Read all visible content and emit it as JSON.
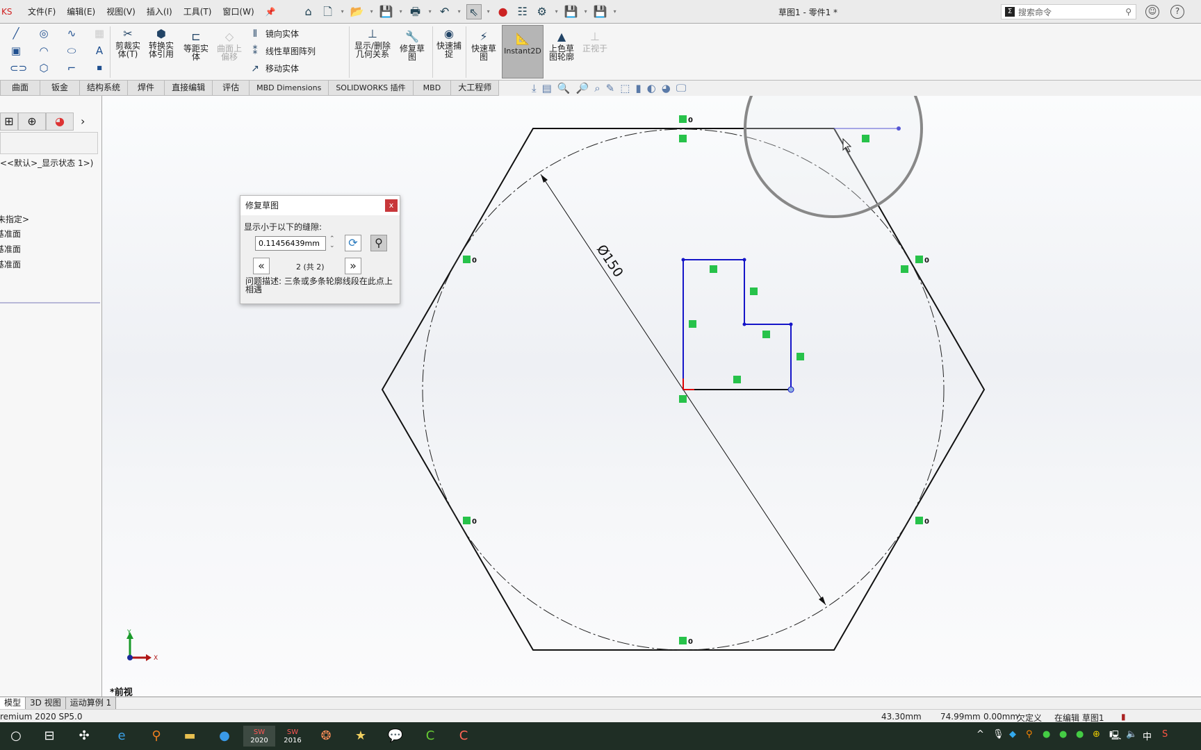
{
  "app": {
    "logo_text": "KS",
    "title": "草图1 - 零件1 *",
    "search_placeholder": "搜索命令"
  },
  "menu": [
    "文件(F)",
    "编辑(E)",
    "视图(V)",
    "插入(I)",
    "工具(T)",
    "窗口(W)"
  ],
  "ribbon": {
    "trim": "剪裁实体(T)",
    "convert": "转换实体引用",
    "offset": "等距实体",
    "surface_offset": "曲面上偏移",
    "mirror": "镜向实体",
    "linear_pattern": "线性草图阵列",
    "move": "移动实体",
    "relations": "显示/删除几何关系",
    "repair": "修复草图",
    "quick_snap": "快速捕捉",
    "rapid_sketch": "快速草图",
    "instant2d": "Instant2D",
    "shaded_contour": "上色草图轮廓",
    "normal_to": "正视于"
  },
  "tabs": [
    "曲面",
    "钣金",
    "结构系统",
    "焊件",
    "直接编辑",
    "评估",
    "MBD Dimensions",
    "SOLIDWORKS 插件",
    "MBD",
    "大工程师"
  ],
  "tree": {
    "config": "<<默认>_显示状态 1>)",
    "material": "未指定>",
    "planes": [
      "基准面",
      "基准面",
      "基准面"
    ]
  },
  "dialog": {
    "title": "修复草图",
    "close": "x",
    "gap_label": "显示小于以下的缝隙:",
    "gap_value": "0.11456439mm",
    "page": "2 (共 2)",
    "description": "问题描述: 三条或多条轮廓线段在此点上相遇"
  },
  "viewport": {
    "dimension": "Ø150",
    "view_name": "*前视",
    "axis_x": "X",
    "axis_y": "Y",
    "relation_label": "0"
  },
  "bottom_tabs": [
    "模型",
    "3D 视图",
    "运动算例 1"
  ],
  "status": {
    "version": "remium 2020 SP5.0",
    "x": "43.30mm",
    "y": "74.99mm",
    "z": "0.00mm",
    "state": "欠定义",
    "editing": "在编辑 草图1"
  },
  "taskbar": {
    "sw2020": "2020",
    "sw2016": "2016",
    "ime": "中"
  },
  "colors": {
    "sketch_blue": "#1515c8",
    "relation_green": "#27c24a",
    "dialog_close": "#c8373a",
    "taskbar": "#1f2e25"
  }
}
